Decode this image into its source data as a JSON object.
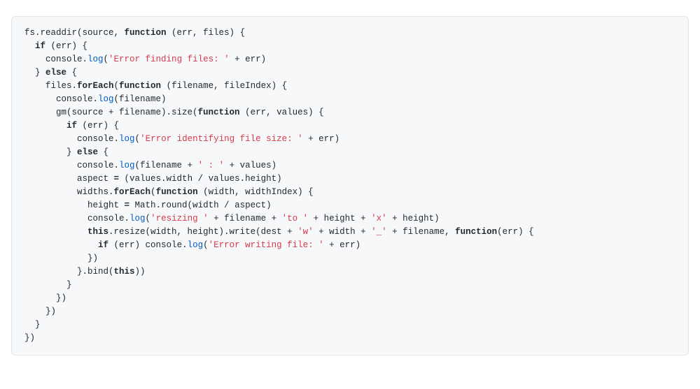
{
  "code": {
    "lines": [
      [
        {
          "c": "pl",
          "t": "fs.readdir(source, "
        },
        {
          "c": "kw",
          "t": "function"
        },
        {
          "c": "pl",
          "t": " (err, files) {"
        }
      ],
      [
        {
          "c": "pl",
          "t": "  "
        },
        {
          "c": "kw",
          "t": "if"
        },
        {
          "c": "pl",
          "t": " (err) {"
        }
      ],
      [
        {
          "c": "pl",
          "t": "    console."
        },
        {
          "c": "fn",
          "t": "log"
        },
        {
          "c": "pl",
          "t": "("
        },
        {
          "c": "str",
          "t": "'Error finding files: '"
        },
        {
          "c": "pl",
          "t": " + err)"
        }
      ],
      [
        {
          "c": "pl",
          "t": "  } "
        },
        {
          "c": "kw",
          "t": "else"
        },
        {
          "c": "pl",
          "t": " {"
        }
      ],
      [
        {
          "c": "pl",
          "t": "    files."
        },
        {
          "c": "bf",
          "t": "forEach"
        },
        {
          "c": "pl",
          "t": "("
        },
        {
          "c": "kw",
          "t": "function"
        },
        {
          "c": "pl",
          "t": " (filename, fileIndex) {"
        }
      ],
      [
        {
          "c": "pl",
          "t": "      console."
        },
        {
          "c": "fn",
          "t": "log"
        },
        {
          "c": "pl",
          "t": "(filename)"
        }
      ],
      [
        {
          "c": "pl",
          "t": "      gm(source + filename).size("
        },
        {
          "c": "kw",
          "t": "function"
        },
        {
          "c": "pl",
          "t": " (err, values) {"
        }
      ],
      [
        {
          "c": "pl",
          "t": "        "
        },
        {
          "c": "kw",
          "t": "if"
        },
        {
          "c": "pl",
          "t": " (err) {"
        }
      ],
      [
        {
          "c": "pl",
          "t": "          console."
        },
        {
          "c": "fn",
          "t": "log"
        },
        {
          "c": "pl",
          "t": "("
        },
        {
          "c": "str",
          "t": "'Error identifying file size: '"
        },
        {
          "c": "pl",
          "t": " + err)"
        }
      ],
      [
        {
          "c": "pl",
          "t": "        } "
        },
        {
          "c": "kw",
          "t": "else"
        },
        {
          "c": "pl",
          "t": " {"
        }
      ],
      [
        {
          "c": "pl",
          "t": "          console."
        },
        {
          "c": "fn",
          "t": "log"
        },
        {
          "c": "pl",
          "t": "(filename + "
        },
        {
          "c": "str",
          "t": "' : '"
        },
        {
          "c": "pl",
          "t": " + values)"
        }
      ],
      [
        {
          "c": "pl",
          "t": "          aspect "
        },
        {
          "c": "bf",
          "t": "="
        },
        {
          "c": "pl",
          "t": " (values.width / values.height)"
        }
      ],
      [
        {
          "c": "pl",
          "t": "          widths."
        },
        {
          "c": "bf",
          "t": "forEach"
        },
        {
          "c": "pl",
          "t": "("
        },
        {
          "c": "kw",
          "t": "function"
        },
        {
          "c": "pl",
          "t": " (width, widthIndex) {"
        }
      ],
      [
        {
          "c": "pl",
          "t": "            height "
        },
        {
          "c": "bf",
          "t": "="
        },
        {
          "c": "pl",
          "t": " Math.round(width / aspect)"
        }
      ],
      [
        {
          "c": "pl",
          "t": "            console."
        },
        {
          "c": "fn",
          "t": "log"
        },
        {
          "c": "pl",
          "t": "("
        },
        {
          "c": "str",
          "t": "'resizing '"
        },
        {
          "c": "pl",
          "t": " + filename + "
        },
        {
          "c": "str",
          "t": "'to '"
        },
        {
          "c": "pl",
          "t": " + height + "
        },
        {
          "c": "str",
          "t": "'x'"
        },
        {
          "c": "pl",
          "t": " + height)"
        }
      ],
      [
        {
          "c": "pl",
          "t": "            "
        },
        {
          "c": "kw",
          "t": "this"
        },
        {
          "c": "pl",
          "t": ".resize(width, height).write(dest + "
        },
        {
          "c": "str",
          "t": "'w'"
        },
        {
          "c": "pl",
          "t": " + width + "
        },
        {
          "c": "str",
          "t": "'_'"
        },
        {
          "c": "pl",
          "t": " + filename, "
        },
        {
          "c": "kw",
          "t": "function"
        },
        {
          "c": "pl",
          "t": "(err) {"
        }
      ],
      [
        {
          "c": "pl",
          "t": "              "
        },
        {
          "c": "kw",
          "t": "if"
        },
        {
          "c": "pl",
          "t": " (err) console."
        },
        {
          "c": "fn",
          "t": "log"
        },
        {
          "c": "pl",
          "t": "("
        },
        {
          "c": "str",
          "t": "'Error writing file: '"
        },
        {
          "c": "pl",
          "t": " + err)"
        }
      ],
      [
        {
          "c": "pl",
          "t": "            })"
        }
      ],
      [
        {
          "c": "pl",
          "t": "          }.bind("
        },
        {
          "c": "kw",
          "t": "this"
        },
        {
          "c": "pl",
          "t": "))"
        }
      ],
      [
        {
          "c": "pl",
          "t": "        }"
        }
      ],
      [
        {
          "c": "pl",
          "t": "      })"
        }
      ],
      [
        {
          "c": "pl",
          "t": "    })"
        }
      ],
      [
        {
          "c": "pl",
          "t": "  }"
        }
      ],
      [
        {
          "c": "pl",
          "t": "})"
        }
      ]
    ]
  }
}
